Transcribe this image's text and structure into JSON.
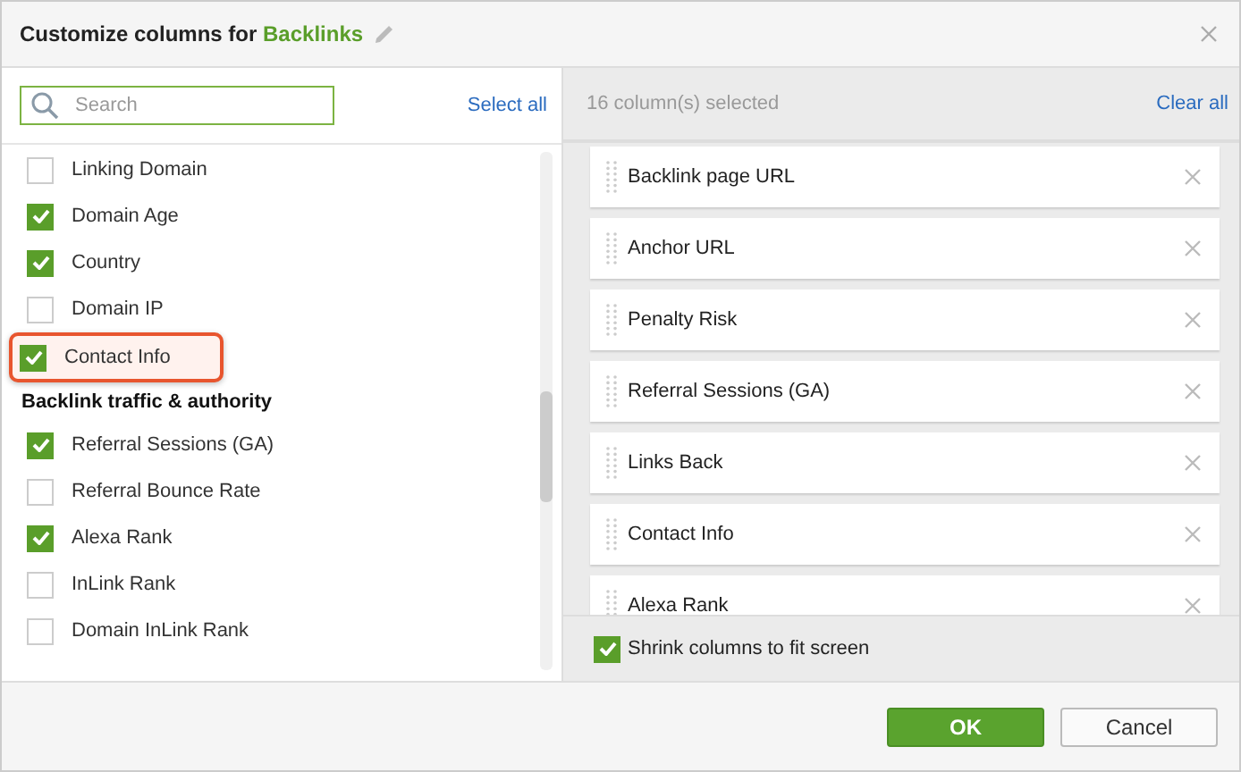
{
  "dialog": {
    "title": "Customize columns for",
    "title_target": "Backlinks"
  },
  "available": {
    "search": {
      "placeholder": "Search"
    },
    "select_all": "Select all",
    "items": [
      {
        "kind": "option",
        "label": "Linking Domain",
        "checked": false,
        "highlighted": false
      },
      {
        "kind": "option",
        "label": "Domain Age",
        "checked": true,
        "highlighted": false
      },
      {
        "kind": "option",
        "label": "Country",
        "checked": true,
        "highlighted": false
      },
      {
        "kind": "option",
        "label": "Domain IP",
        "checked": false,
        "highlighted": false
      },
      {
        "kind": "option",
        "label": "Contact Info",
        "checked": true,
        "highlighted": true
      },
      {
        "kind": "group",
        "label": "Backlink traffic & authority"
      },
      {
        "kind": "option",
        "label": "Referral Sessions (GA)",
        "checked": true,
        "highlighted": false
      },
      {
        "kind": "option",
        "label": "Referral Bounce Rate",
        "checked": false,
        "highlighted": false
      },
      {
        "kind": "option",
        "label": "Alexa Rank",
        "checked": true,
        "highlighted": false
      },
      {
        "kind": "option",
        "label": "InLink Rank",
        "checked": false,
        "highlighted": false
      },
      {
        "kind": "option",
        "label": "Domain InLink Rank",
        "checked": false,
        "highlighted": false
      }
    ]
  },
  "selected": {
    "count_label": "16 column(s) selected",
    "clear_all": "Clear all",
    "columns": [
      "Backlink page URL",
      "Anchor URL",
      "Penalty Risk",
      "Referral Sessions (GA)",
      "Links Back",
      "Contact Info",
      "Alexa Rank"
    ],
    "shrink": {
      "label": "Shrink columns to fit screen",
      "checked": true
    }
  },
  "buttons": {
    "ok": "OK",
    "cancel": "Cancel"
  }
}
